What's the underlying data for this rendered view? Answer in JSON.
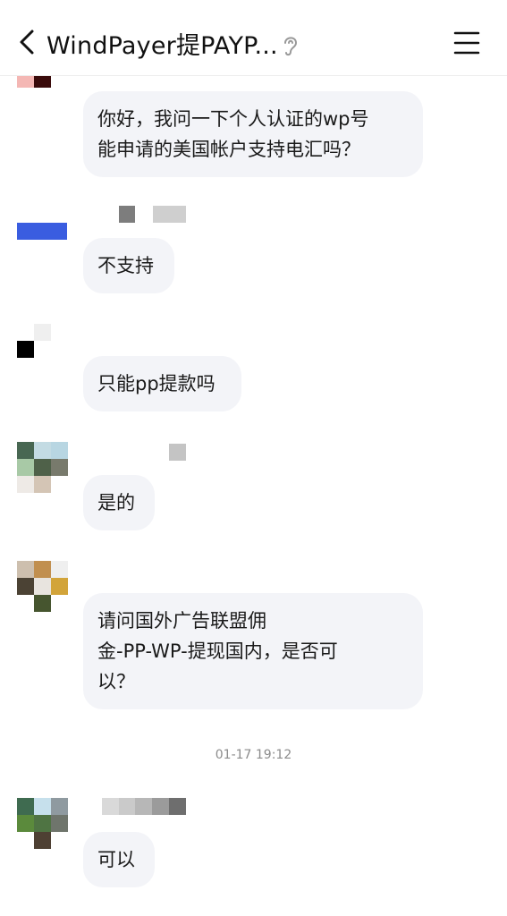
{
  "header": {
    "title": "WindPayer提PAYP...",
    "back_icon": "chevron-left-icon",
    "ear_icon": "ear-icon",
    "menu_icon": "hamburger-menu-icon"
  },
  "messages": [
    {
      "text_lines": [
        "你好，我问一下个人认证的wp号",
        "能申请的美国帐户支持电汇吗？"
      ]
    },
    {
      "text_lines": [
        "不支持"
      ]
    },
    {
      "text_lines": [
        "只能pp提款吗"
      ]
    },
    {
      "text_lines": [
        "是的"
      ]
    },
    {
      "text_lines": [
        "请问国外广告联盟佣",
        "金-PP-WP-提现国内，是否可",
        "以？"
      ]
    },
    {
      "text_lines": [
        "可以"
      ]
    }
  ],
  "timestamp": "01-17 19:12",
  "colors": {
    "bubble_bg": "#f3f4f8",
    "header_bg": "#ffffff",
    "timestamp": "#8c8c8c"
  }
}
